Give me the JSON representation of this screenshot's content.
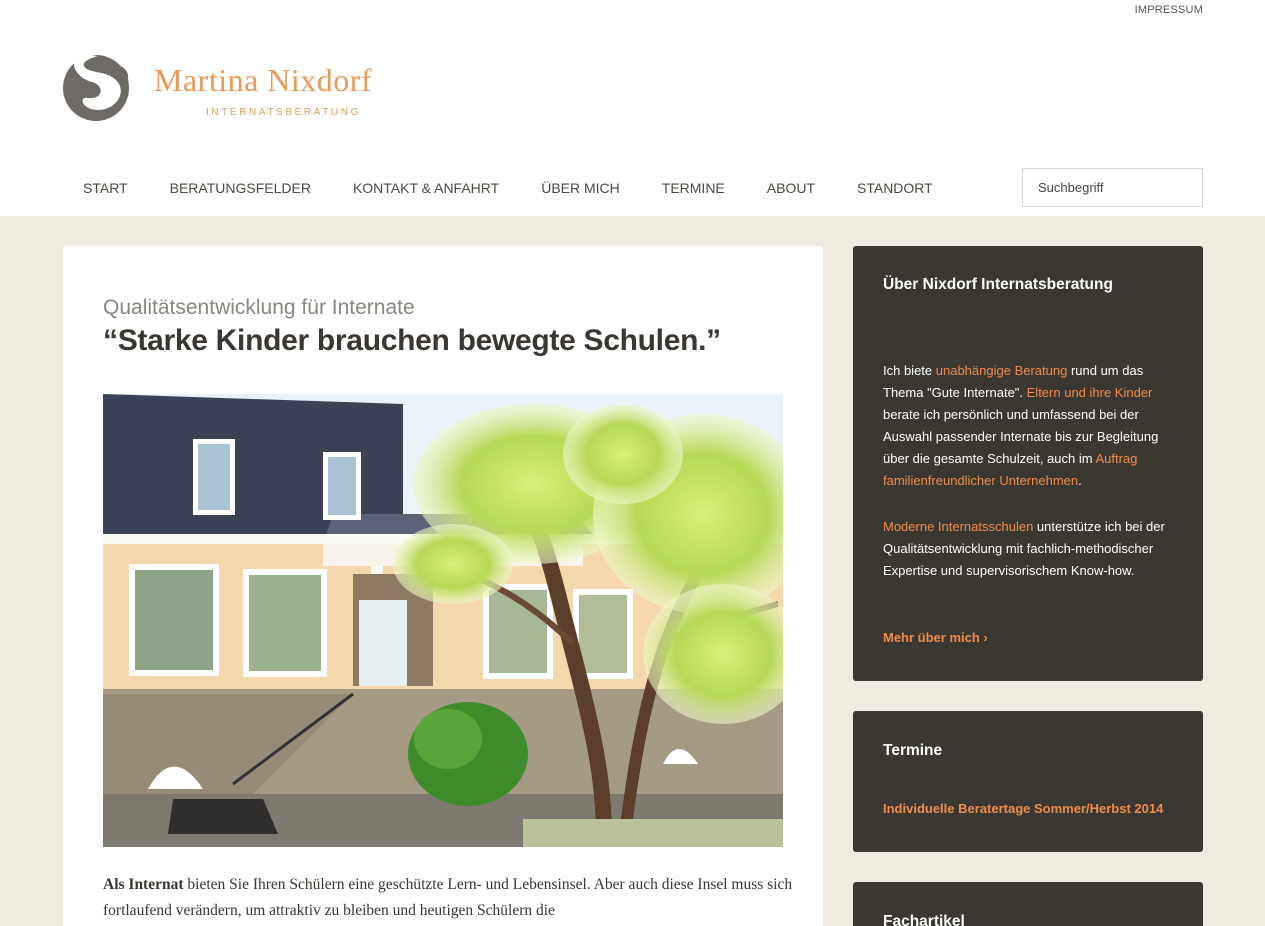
{
  "top": {
    "impressum": "IMPRESSUM"
  },
  "brand": {
    "name": "Martina Nixdorf",
    "tagline": "INTERNATSBERATUNG"
  },
  "nav": {
    "items": [
      {
        "label": "START"
      },
      {
        "label": "BERATUNGSFELDER"
      },
      {
        "label": "KONTAKT & ANFAHRT"
      },
      {
        "label": "ÜBER MICH"
      },
      {
        "label": "TERMINE"
      },
      {
        "label": "ABOUT"
      },
      {
        "label": "STANDORT"
      }
    ]
  },
  "search": {
    "placeholder": "Suchbegriff"
  },
  "article": {
    "kicker": "Qualitätsentwicklung für Internate",
    "headline": "“Starke Kinder brauchen bewegte Schulen.”",
    "lead_bold": "Als Internat",
    "lead_text": " bieten Sie Ihren Schülern eine geschützte Lern- und Lebensinsel. Aber auch diese Insel muss sich fortlaufend verändern, um attraktiv zu bleiben und heutigen Schülern die"
  },
  "sidebar": {
    "about": {
      "title": "Über Nixdorf Internatsberatung",
      "p1": {
        "t1": "Ich biete ",
        "l1": "unabhängige Beratung",
        "t2": " rund um das Thema \"Gute Internate\". ",
        "l2": "Eltern und ihre Kinder",
        "t3": " berate ich persönlich und umfassend bei der Auswahl passender Internate bis zur Begleitung über die gesamte Schulzeit, auch im ",
        "l3": "Auftrag familienfreundlicher Unternehmen",
        "t4": "."
      },
      "p2": {
        "l1": "Moderne Internatsschulen",
        "t1": " unterstütze ich bei der Qualitätsentwicklung mit fachlich-methodischer Expertise und supervisorischem Know-how."
      },
      "more": "Mehr über mich ›"
    },
    "termine": {
      "title": "Termine",
      "event": "Individuelle Beratertage Sommer/Herbst 2014"
    },
    "fachartikel": {
      "title": "Fachartikel"
    }
  },
  "colors": {
    "accent": "#ef8b4d",
    "brand": "#e99a58",
    "widget_bg": "#3b3831",
    "page_bg": "#f0ebe0",
    "logo_grey": "#6e6b66"
  }
}
